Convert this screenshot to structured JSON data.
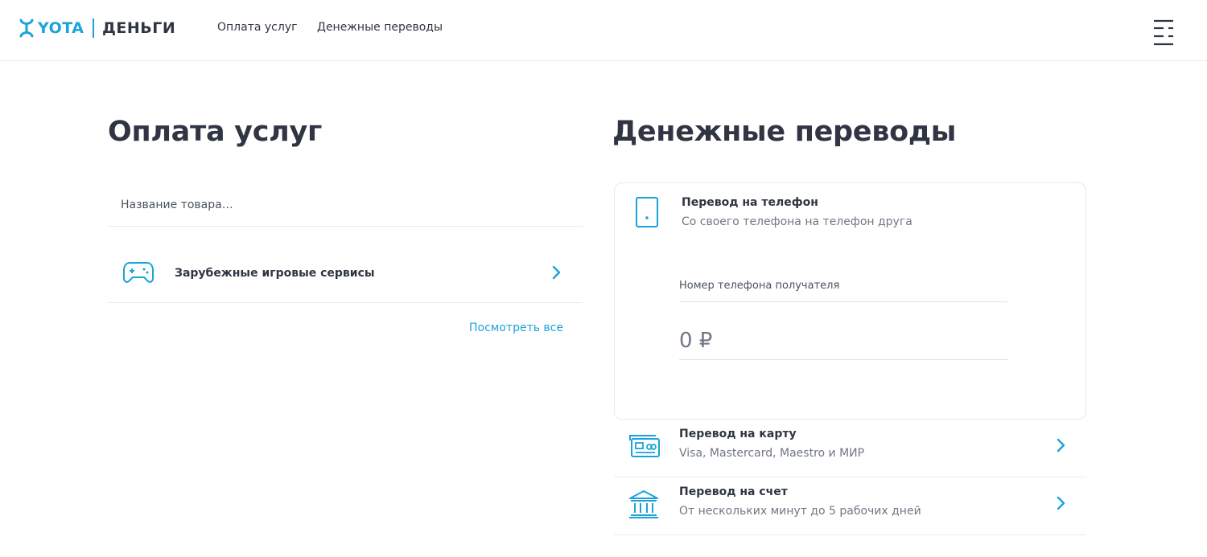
{
  "header": {
    "logo_left": "YOTA",
    "logo_right": "ДЕНЬГИ",
    "nav": [
      {
        "label": "Оплата услуг"
      },
      {
        "label": "Денежные переводы"
      }
    ]
  },
  "payments": {
    "title": "Оплата услуг",
    "search_placeholder": "Название товара…",
    "services": [
      {
        "label": "Зарубежные игровые сервисы",
        "icon": "gamepad-icon"
      }
    ],
    "view_all": "Посмотреть все"
  },
  "transfers": {
    "title": "Денежные переводы",
    "phone": {
      "title": "Перевод на телефон",
      "subtitle": "Со своего телефона на телефон друга",
      "recipient_placeholder": "Номер телефона получателя",
      "amount_placeholder": "0 ₽",
      "icon": "phone-icon"
    },
    "items": [
      {
        "title": "Перевод на карту",
        "subtitle": "Visa, Mastercard, Maestro и МИР",
        "icon": "card-icon"
      },
      {
        "title": "Перевод на счет",
        "subtitle": "От нескольких минут до 5 рабочих дней",
        "icon": "bank-icon"
      }
    ]
  },
  "colors": {
    "accent": "#1aa3db",
    "text": "#2f3542",
    "muted": "#707784",
    "divider": "#e8eaed"
  }
}
